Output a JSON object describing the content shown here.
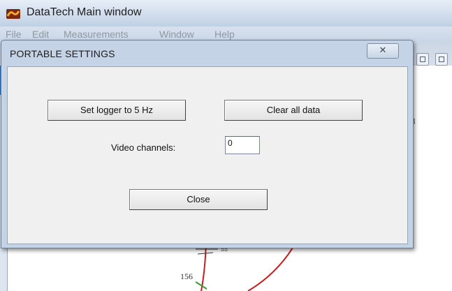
{
  "main_window": {
    "title": "DataTech Main window",
    "menu": [
      "File",
      "Edit",
      "Measurements",
      "Window",
      "Help"
    ],
    "side_number": "8"
  },
  "drawing": {
    "labels": {
      "a": "156",
      "b": "55"
    }
  },
  "dialog": {
    "title": "PORTABLE SETTINGS",
    "close_glyph": "✕",
    "set_logger_label": "Set logger to 5 Hz",
    "clear_data_label": "Clear all data",
    "video_channels_label": "Video channels:",
    "video_channels_value": "0",
    "close_label": "Close"
  },
  "colors": {
    "dialog_frame": "#c4d3e6",
    "dialog_body": "#f0f0f0",
    "curve": "#c81d1d"
  }
}
